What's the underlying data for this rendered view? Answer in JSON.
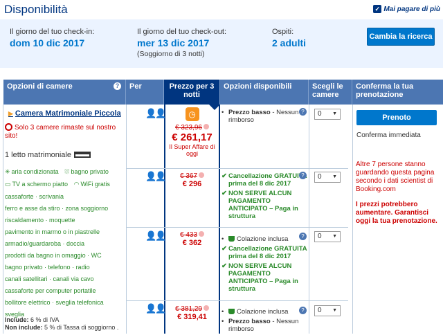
{
  "header": {
    "title": "Disponibilità",
    "no_pay_label": "Mai pagare di più"
  },
  "search": {
    "checkin_label": "Il giorno del tuo check-in:",
    "checkin_value": "dom 10 dic 2017",
    "checkout_label": "Il giorno del tuo check-out:",
    "checkout_value": "mer 13 dic 2017",
    "nights": "(Soggiorno di 3 notti)",
    "guests_label": "Ospiti:",
    "guests_value": "2 adulti",
    "change_button": "Cambia la ricerca"
  },
  "table": {
    "headers": {
      "room_options": "Opzioni di camere",
      "per": "Per",
      "price": "Prezzo per 3 notti",
      "options": "Opzioni disponibili",
      "choose": "Scegli le camere",
      "confirm": "Conferma la tua prenotazione"
    }
  },
  "room": {
    "name": "Camera Matrimoniale Piccola",
    "scarcity": "Solo 3 camere rimaste sul nostro sito!",
    "bed": "1 letto matrimoniale",
    "facilities": [
      "aria condizionata",
      "bagno privato",
      "TV a schermo piatto",
      "WiFi gratis",
      "cassaforte · scrivania",
      "ferro e asse da stiro · zona soggiorno",
      "riscaldamento · moquette",
      "pavimento in marmo o in piastrelle",
      "armadio/guardaroba · doccia",
      "prodotti da bagno in omaggio · WC",
      "bagno privato · telefono · radio",
      "canali satellitari · canali via cavo",
      "cassaforte per computer portatile",
      "bollitore elettrico · sveglia telefonica",
      "sveglia"
    ],
    "included_label": "Include:",
    "included": "6 % di IVA",
    "not_included_label": "Non include:",
    "not_included": "5 % di Tassa di soggiorno ."
  },
  "rows": [
    {
      "old_price": "€ 323,96",
      "new_price": "€ 261,17",
      "deal": "Il Super Affare di oggi",
      "options": [
        {
          "text": "Prezzo basso",
          "rest": " - Nessun rimborso"
        }
      ],
      "qty": "0"
    },
    {
      "old_price": "€ 367",
      "new_price": "€ 296",
      "options": [
        {
          "text": "Cancellazione GRATUITA prima del 8 dic 2017"
        },
        {
          "text": "NON SERVE ALCUN PAGAMENTO ANTICIPATO – Paga in struttura"
        }
      ],
      "qty": "0"
    },
    {
      "old_price": "€ 433",
      "new_price": "€ 362",
      "breakfast": "Colazione inclusa",
      "options": [
        {
          "text": "Cancellazione GRATUITA prima del 8 dic 2017"
        },
        {
          "text": "NON SERVE ALCUN PAGAMENTO ANTICIPATO – Paga in struttura"
        }
      ],
      "qty": "0"
    },
    {
      "old_price": "€ 381,29",
      "new_price": "€ 319,41",
      "breakfast": "Colazione inclusa",
      "options": [
        {
          "text": "Prezzo basso",
          "rest": " - Nessun rimborso"
        }
      ],
      "qty": "0"
    }
  ],
  "booking": {
    "button": "Prenoto",
    "confirm_note": "Conferma immediata",
    "viewers": "Altre 7 persone stanno guardando questa pagina secondo i dati scientist di Booking.com",
    "price_warning": "I prezzi potrebbero aumentare. Garantisci oggi la tua prenotazione."
  },
  "colors": {
    "brand": "#003580",
    "accent": "#0077cc",
    "header_bg": "#4c76b2",
    "alert": "#cc0000",
    "positive": "#2a8a2a"
  }
}
